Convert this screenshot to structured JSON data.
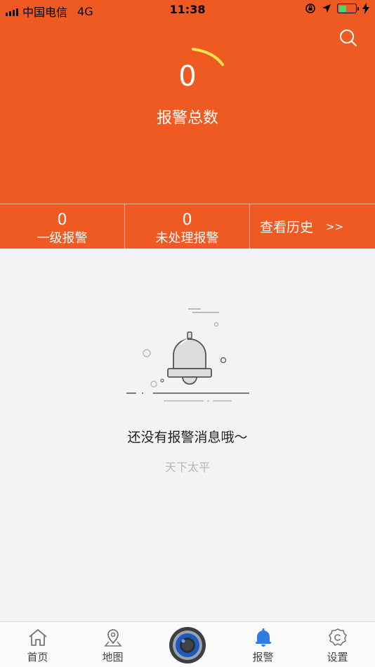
{
  "status_bar": {
    "carrier": "中国电信",
    "network": "4G",
    "time": "11:38"
  },
  "header": {
    "total_count": "0",
    "total_label": "报警总数"
  },
  "stats": [
    {
      "value": "0",
      "label": "一级报警"
    },
    {
      "value": "0",
      "label": "未处理报警"
    }
  ],
  "history_link": {
    "label": "查看历史",
    "arrow": ">>"
  },
  "empty_state": {
    "title": "还没有报警消息哦～",
    "subtitle": "天下太平"
  },
  "tabs": [
    {
      "label": "首页",
      "icon": "home-icon"
    },
    {
      "label": "地图",
      "icon": "map-pin-icon"
    },
    {
      "label": "报警",
      "icon": "bell-icon"
    },
    {
      "label": "设置",
      "icon": "settings-icon"
    }
  ],
  "colors": {
    "accent": "#ef5a22",
    "tab_active": "#2f7de1",
    "background": "#f2f3f5"
  }
}
